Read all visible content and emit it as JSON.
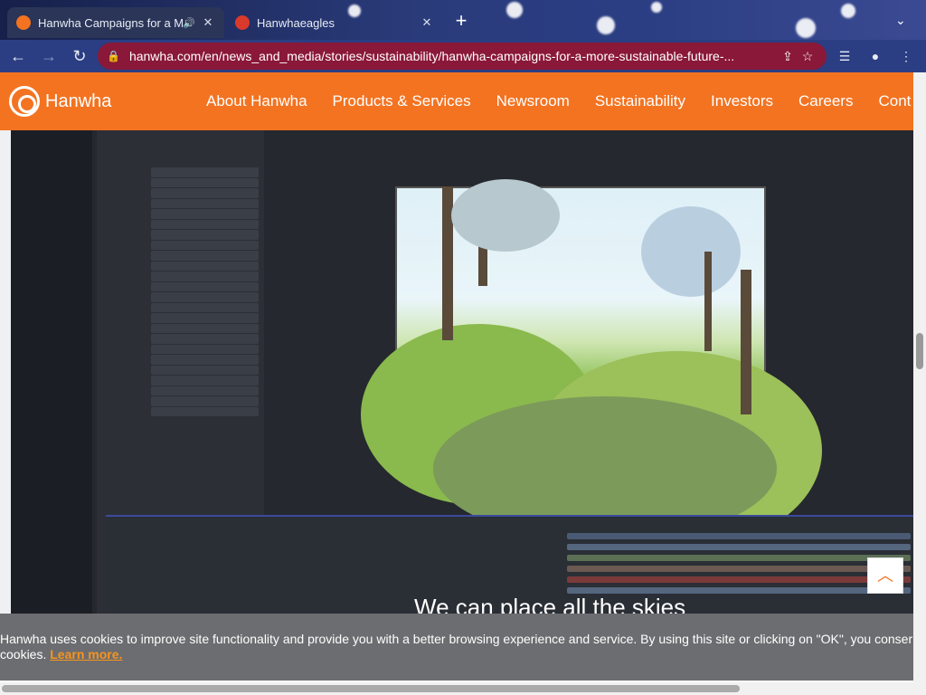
{
  "browser": {
    "tabs": [
      {
        "title": "Hanwha Campaigns for a Mo",
        "active": true,
        "audio": true
      },
      {
        "title": "Hanwhaeagles",
        "active": false
      }
    ],
    "new_tab": "+",
    "address": "hanwha.com/en/news_and_media/stories/sustainability/hanwha-campaigns-for-a-more-sustainable-future-..."
  },
  "site": {
    "logo_text": "Hanwha",
    "nav": [
      "About Hanwha",
      "Products & Services",
      "Newsroom",
      "Sustainability",
      "Investors",
      "Careers",
      "Cont"
    ],
    "accent": "#f37321"
  },
  "video": {
    "subtitle": "We can place all the skies"
  },
  "cookie": {
    "text_line1": "Hanwha uses cookies to improve site functionality and provide you with a better browsing experience and service. By using this site or clicking on \"OK\", you conser",
    "text_line2": "cookies.",
    "learn_more": "Learn more."
  },
  "to_top_icon": "chevron-up-icon"
}
